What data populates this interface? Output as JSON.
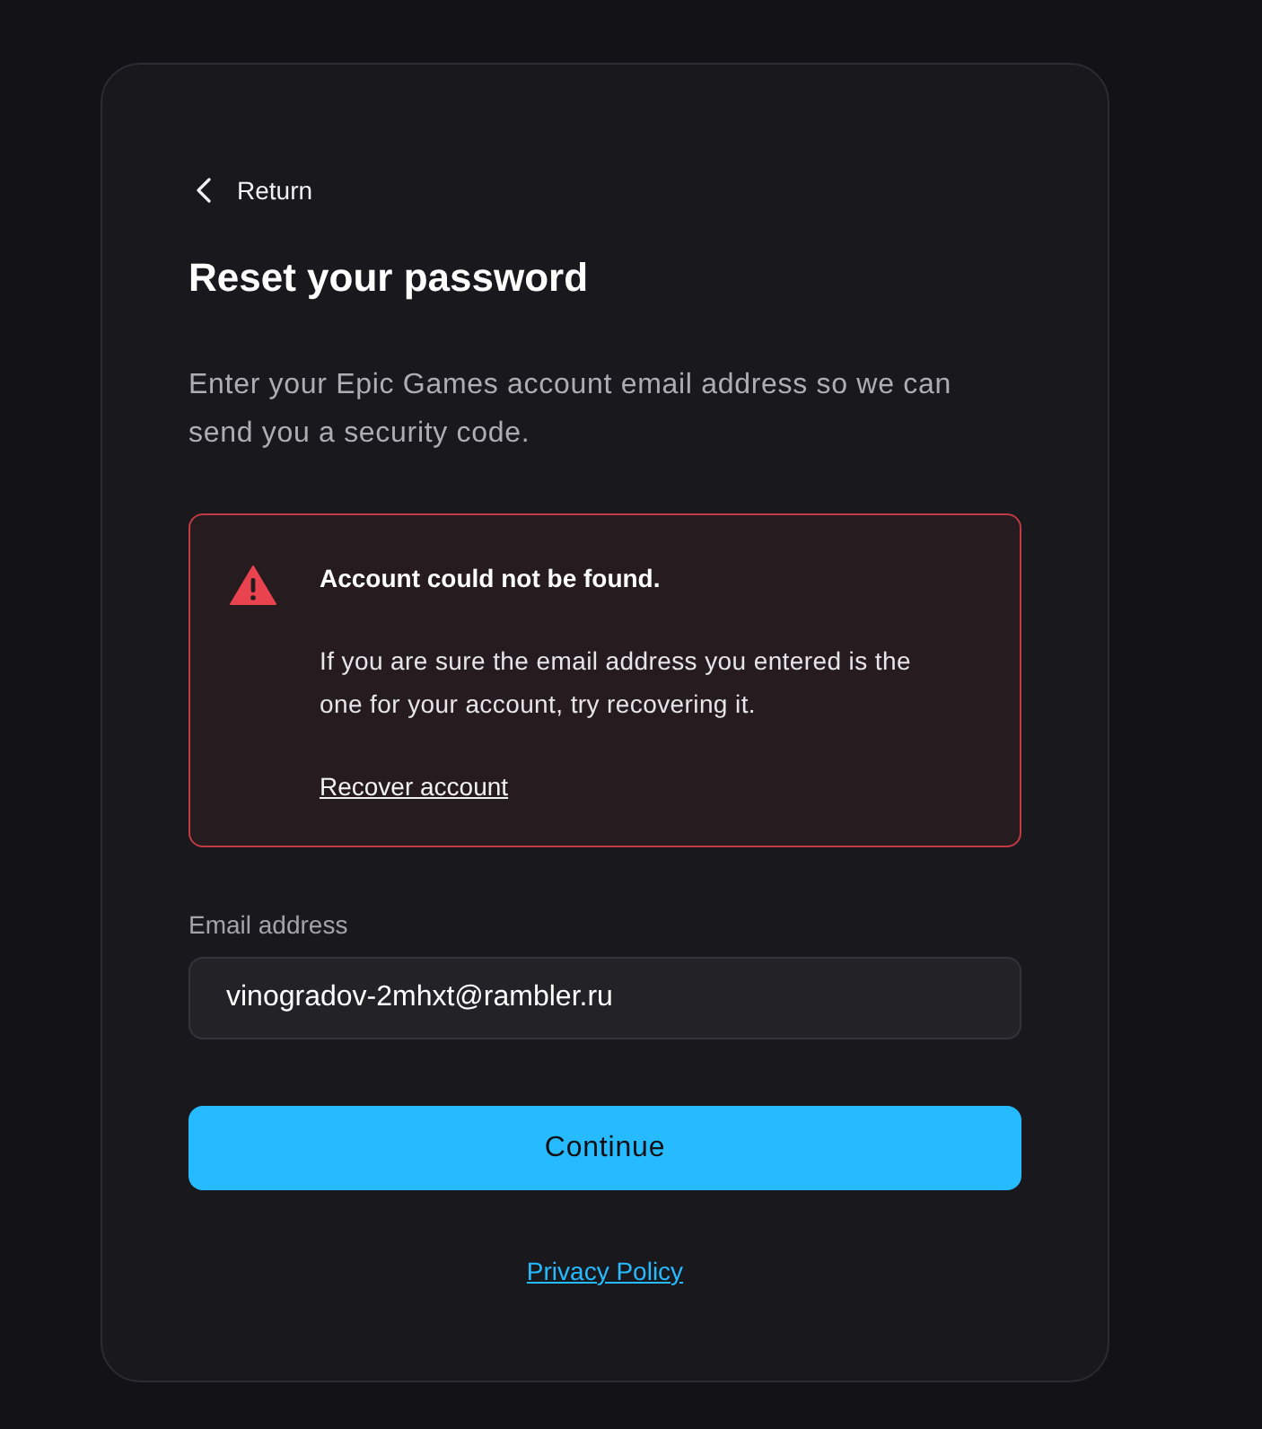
{
  "back_link": {
    "label": "Return"
  },
  "title": "Reset your password",
  "description": "Enter your Epic Games account email address so we can send you a security code.",
  "alert": {
    "kind": "error",
    "title": "Account could not be found.",
    "message": "If you are sure the email address you entered is the one for your account, try recovering it.",
    "link": "Recover account"
  },
  "email_field": {
    "label": "Email address",
    "value": "vinogradov-2mhxt@rambler.ru"
  },
  "continue_button": {
    "label": "Continue"
  },
  "footer_link": {
    "label": "Privacy Policy"
  }
}
